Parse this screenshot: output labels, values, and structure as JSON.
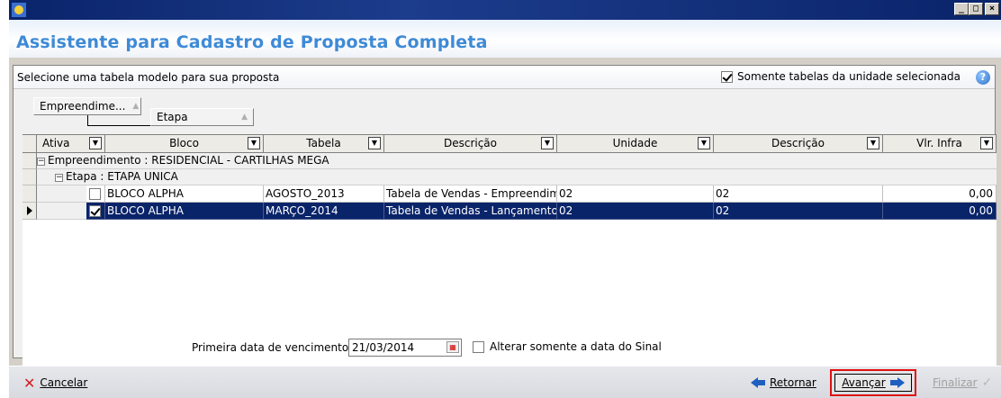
{
  "window": {
    "title": ""
  },
  "wizard": {
    "title": "Assistente para Cadastro de Proposta Completa"
  },
  "panel": {
    "caption": "Selecione uma tabela modelo para sua proposta",
    "only_unit_checkbox": {
      "label": "Somente tabelas da unidade selecionada",
      "checked": true
    },
    "help": "?"
  },
  "grouping": {
    "chips": [
      "Empreendime...",
      "Etapa"
    ]
  },
  "grid": {
    "columns": [
      "Ativa",
      "Bloco",
      "Tabela",
      "Descrição",
      "Unidade",
      "Descrição",
      "Vlr. Infra"
    ],
    "group1": "Empreendimento : RESIDENCIAL - CARTILHAS MEGA",
    "group2": "Etapa : ETAPA UNICA",
    "rows": [
      {
        "ativa": false,
        "bloco": "BLOCO ALPHA",
        "tabela": "AGOSTO_2013",
        "descricao": "Tabela de Vendas - Empreendime",
        "unidade": "02",
        "descricao2": "02",
        "vlr_infra": "0,00",
        "selected": false
      },
      {
        "ativa": true,
        "bloco": "BLOCO ALPHA",
        "tabela": "MARÇO_2014",
        "descricao": "Tabela de Vendas - Lançamento",
        "unidade": "02",
        "descricao2": "02",
        "vlr_infra": "0,00",
        "selected": true
      }
    ]
  },
  "first_due": {
    "label": "Primeira data de vencimento:",
    "value": "21/03/2014"
  },
  "alter_sinal": {
    "label": "Alterar somente a data do Sinal",
    "checked": false
  },
  "footer": {
    "cancel": "Cancelar",
    "back": "Retornar",
    "next": "Avançar",
    "finish": "Finalizar"
  },
  "colors": {
    "title_text": "#3e8ad6",
    "selection": "#0a246a",
    "highlight_border": "#e01010"
  }
}
